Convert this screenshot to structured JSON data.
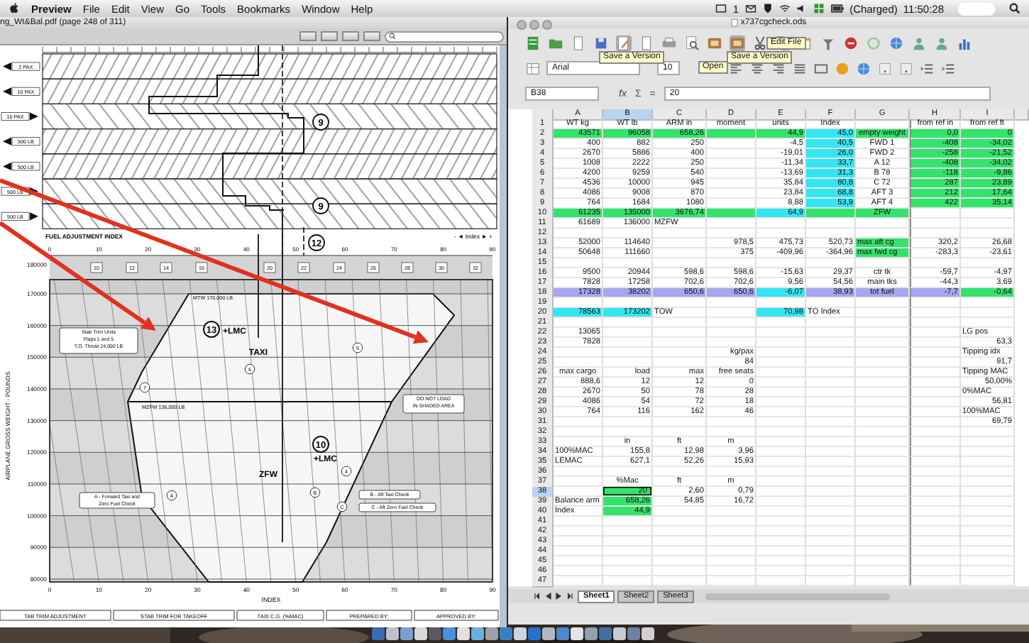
{
  "menu_bar": {
    "items": [
      "Preview",
      "File",
      "Edit",
      "View",
      "Go",
      "Tools",
      "Bookmarks",
      "Window",
      "Help"
    ],
    "space": "1",
    "battery": "(Charged)",
    "time": "11:50:28"
  },
  "preview": {
    "title": "ng_Wt&Bal.pdf (page 248 of 311)",
    "pax_rows": [
      {
        "label": "2 PAX",
        "kind": "left"
      },
      {
        "label": "10 PAX",
        "kind": "left"
      },
      {
        "label": "10 PAX",
        "kind": "right"
      },
      {
        "label": "500 LB",
        "kind": "left"
      },
      {
        "label": "500 LB",
        "kind": "left"
      },
      {
        "label": "500 LB",
        "kind": "right"
      },
      {
        "label": "500 LB",
        "kind": "right"
      }
    ],
    "steps": [
      "9",
      "9",
      "12"
    ],
    "fuel_title": "FUEL ADJUSTMENT INDEX",
    "fuel_legend": "- ◄ Index ► +",
    "fuel_ticks": [
      "0",
      "10",
      "20",
      "30",
      "40",
      "50",
      "60",
      "70",
      "80",
      "90"
    ],
    "trim_boxes": [
      "10",
      "12",
      "14",
      "16",
      "20",
      "22",
      "24",
      "26",
      "28",
      "30",
      "32"
    ],
    "top_weight": "180000",
    "weight_ticks": [
      "170000",
      "160000",
      "150000",
      "140000",
      "130000",
      "120000",
      "110000",
      "100000",
      "90000",
      "80000"
    ],
    "index_ticks": [
      "0",
      "10",
      "20",
      "30",
      "40",
      "50",
      "60",
      "70",
      "80",
      "90"
    ],
    "x_title": "INDEX",
    "y_title": "AIRPLANE GROSS WEIGHT - POUNDS",
    "limit_lines": [
      "MTW 170,000 LB",
      "MZFW 136,000 LB"
    ],
    "notes": [
      {
        "lines": [
          "Stab Trim Units",
          "Flaps 1 and 5",
          "T.O. Thrust 24,000 LB"
        ]
      },
      {
        "lines": [
          "DO NOT LOAD",
          "IN SHADED AREA"
        ]
      },
      {
        "lines": [
          "A - Forward Taxi and",
          "Zero Fuel Check"
        ]
      },
      {
        "lines": [
          "B - Aft Taxi Check"
        ]
      },
      {
        "lines": [
          "C - Aft Zero Fuel Check"
        ]
      }
    ],
    "check_points": [
      {
        "number": "13",
        "mark": "+LMC",
        "label": "TAXI"
      },
      {
        "number": "10",
        "mark": "+LMC",
        "label": "ZFW"
      }
    ],
    "circled": [
      "5",
      "6",
      "7",
      "4",
      "A",
      "B",
      "C"
    ],
    "footer": [
      "TAB TRIM ADJUSTMENT",
      "STAB TRIM FOR TAKEOFF",
      "TAXI C.G. (%MAC)",
      "PREPARED BY:",
      "APPROVED BY:"
    ]
  },
  "calc": {
    "title": "x737cgcheck.ods",
    "tooltips": [
      "Edit File",
      "Save a Version",
      "Save a Version",
      "Open"
    ],
    "font": "Arial",
    "size": "10",
    "cell_ref": "B38",
    "formula_buttons": [
      "fx",
      "Σ",
      "="
    ],
    "formula": "20",
    "columns": [
      "A",
      "B",
      "C",
      "D",
      "E",
      "F",
      "G",
      "H",
      "I"
    ],
    "rows": [
      {
        "n": "1",
        "cells": [
          {
            "text": "WT kg",
            "kind": "center"
          },
          {
            "text": "WT lb",
            "kind": "center"
          },
          {
            "text": "ARM in",
            "kind": "center"
          },
          {
            "text": "moment",
            "kind": "center"
          },
          {
            "text": "units",
            "kind": "center"
          },
          {
            "text": "Index",
            "kind": "center"
          },
          {},
          {
            "text": "from ref in",
            "kind": "center"
          },
          {
            "text": "from ref ft",
            "kind": "center"
          }
        ]
      },
      {
        "n": "2",
        "cells": [
          {
            "text": "43571",
            "kind": "num",
            "color": "#33e36b"
          },
          {
            "text": "96058",
            "kind": "num",
            "color": "#33e36b"
          },
          {
            "text": "658,26",
            "kind": "num",
            "color": "#33e36b"
          },
          {
            "color": "#33e36b"
          },
          {
            "text": "44,9",
            "kind": "num",
            "color": "#33e36b"
          },
          {
            "text": "45,0",
            "kind": "num",
            "color": "#33e6f2"
          },
          {
            "text": "empty weight",
            "kind": "center",
            "color": "#33e36b"
          },
          {
            "text": "0,0",
            "kind": "num",
            "color": "#33e36b"
          },
          {
            "text": "0",
            "kind": "num",
            "color": "#33e36b"
          }
        ]
      },
      {
        "n": "3",
        "cells": [
          {
            "text": "400",
            "kind": "num"
          },
          {
            "text": "882",
            "kind": "num"
          },
          {
            "text": "250",
            "kind": "num"
          },
          {},
          {
            "text": "-4,5",
            "kind": "num"
          },
          {
            "text": "40,5",
            "kind": "num",
            "color": "#33e6f2"
          },
          {
            "text": "FWD 1",
            "kind": "center"
          },
          {
            "text": "-408",
            "kind": "num",
            "color": "#33e36b"
          },
          {
            "text": "-34,02",
            "kind": "num",
            "color": "#33e36b"
          }
        ]
      },
      {
        "n": "4",
        "cells": [
          {
            "text": "2670",
            "kind": "num"
          },
          {
            "text": "5886",
            "kind": "num"
          },
          {
            "text": "400",
            "kind": "num"
          },
          {},
          {
            "text": "-19,01",
            "kind": "num"
          },
          {
            "text": "26,0",
            "kind": "num",
            "color": "#33e6f2"
          },
          {
            "text": "FWD 2",
            "kind": "center"
          },
          {
            "text": "-258",
            "kind": "num",
            "color": "#33e36b"
          },
          {
            "text": "-21,52",
            "kind": "num",
            "color": "#33e36b"
          }
        ]
      },
      {
        "n": "5",
        "cells": [
          {
            "text": "1008",
            "kind": "num"
          },
          {
            "text": "2222",
            "kind": "num"
          },
          {
            "text": "250",
            "kind": "num"
          },
          {},
          {
            "text": "-11,34",
            "kind": "num"
          },
          {
            "text": "33,7",
            "kind": "num",
            "color": "#33e6f2"
          },
          {
            "text": "A 12",
            "kind": "center"
          },
          {
            "text": "-408",
            "kind": "num",
            "color": "#33e36b"
          },
          {
            "text": "-34,02",
            "kind": "num",
            "color": "#33e36b"
          }
        ]
      },
      {
        "n": "6",
        "cells": [
          {
            "text": "4200",
            "kind": "num"
          },
          {
            "text": "9259",
            "kind": "num"
          },
          {
            "text": "540",
            "kind": "num"
          },
          {},
          {
            "text": "-13,69",
            "kind": "num"
          },
          {
            "text": "31,3",
            "kind": "num",
            "color": "#33e6f2"
          },
          {
            "text": "B 78",
            "kind": "center"
          },
          {
            "text": "-118",
            "kind": "num",
            "color": "#33e36b"
          },
          {
            "text": "-9,86",
            "kind": "num",
            "color": "#33e36b"
          }
        ]
      },
      {
        "n": "7",
        "cells": [
          {
            "text": "4536",
            "kind": "num"
          },
          {
            "text": "10000",
            "kind": "num"
          },
          {
            "text": "945",
            "kind": "num"
          },
          {},
          {
            "text": "35,84",
            "kind": "num"
          },
          {
            "text": "80,8",
            "kind": "num",
            "color": "#33e6f2"
          },
          {
            "text": "C 72",
            "kind": "center"
          },
          {
            "text": "287",
            "kind": "num",
            "color": "#33e36b"
          },
          {
            "text": "23,89",
            "kind": "num",
            "color": "#33e36b"
          }
        ]
      },
      {
        "n": "8",
        "cells": [
          {
            "text": "4086",
            "kind": "num"
          },
          {
            "text": "9008",
            "kind": "num"
          },
          {
            "text": "870",
            "kind": "num"
          },
          {},
          {
            "text": "23,84",
            "kind": "num"
          },
          {
            "text": "68,8",
            "kind": "num",
            "color": "#33e6f2"
          },
          {
            "text": "AFT 3",
            "kind": "center"
          },
          {
            "text": "212",
            "kind": "num",
            "color": "#33e36b"
          },
          {
            "text": "17,64",
            "kind": "num",
            "color": "#33e36b"
          }
        ]
      },
      {
        "n": "9",
        "cells": [
          {
            "text": "764",
            "kind": "num"
          },
          {
            "text": "1684",
            "kind": "num"
          },
          {
            "text": "1080",
            "kind": "num"
          },
          {},
          {
            "text": "8,88",
            "kind": "num"
          },
          {
            "text": "53,9",
            "kind": "num",
            "color": "#33e6f2"
          },
          {
            "text": "AFT 4",
            "kind": "center"
          },
          {
            "text": "422",
            "kind": "num",
            "color": "#33e36b"
          },
          {
            "text": "35,14",
            "kind": "num",
            "color": "#33e36b"
          }
        ]
      },
      {
        "n": "10",
        "cells": [
          {
            "text": "61235",
            "kind": "num",
            "color": "#33e36b"
          },
          {
            "text": "135000",
            "kind": "num",
            "color": "#33e36b"
          },
          {
            "text": "3676,74",
            "kind": "num",
            "color": "#33e36b"
          },
          {
            "color": "#33e36b"
          },
          {
            "text": "64,9",
            "kind": "num",
            "color": "#33e6f2"
          },
          {
            "color": "#33e36b"
          },
          {
            "text": "ZFW",
            "kind": "center",
            "color": "#33e36b"
          }
        ]
      },
      {
        "n": "11",
        "cells": [
          {
            "text": "61689",
            "kind": "num"
          },
          {
            "text": "136000",
            "kind": "num"
          },
          {
            "text": "MZFW",
            "kind": "text"
          }
        ]
      },
      {
        "n": "12"
      },
      {
        "n": "13",
        "cells": [
          {
            "text": "52000",
            "kind": "num"
          },
          {
            "text": "114640",
            "kind": "num"
          },
          {},
          {
            "text": "978,5",
            "kind": "num"
          },
          {
            "text": "475,73",
            "kind": "num"
          },
          {
            "text": "520,73",
            "kind": "num"
          },
          {
            "text": "max aft cg",
            "kind": "text",
            "color": "#33e36b"
          },
          {
            "text": "320,2",
            "kind": "num"
          },
          {
            "text": "26,68",
            "kind": "num"
          }
        ]
      },
      {
        "n": "14",
        "cells": [
          {
            "text": "50648",
            "kind": "num"
          },
          {
            "text": "111660",
            "kind": "num"
          },
          {},
          {
            "text": "375",
            "kind": "num"
          },
          {
            "text": "-409,96",
            "kind": "num"
          },
          {
            "text": "-364,96",
            "kind": "num"
          },
          {
            "text": "max fwd cg",
            "kind": "text",
            "color": "#33e36b"
          },
          {
            "text": "-283,3",
            "kind": "num"
          },
          {
            "text": "-23,61",
            "kind": "num"
          }
        ]
      },
      {
        "n": "15"
      },
      {
        "n": "16",
        "cells": [
          {
            "text": "9500",
            "kind": "num"
          },
          {
            "text": "20944",
            "kind": "num"
          },
          {
            "text": "598,6",
            "kind": "num"
          },
          {
            "text": "598,6",
            "kind": "num"
          },
          {
            "text": "-15,63",
            "kind": "num"
          },
          {
            "text": "29,37",
            "kind": "num"
          },
          {
            "text": "ctr tk",
            "kind": "center"
          },
          {
            "text": "-59,7",
            "kind": "num"
          },
          {
            "text": "-4,97",
            "kind": "num"
          }
        ]
      },
      {
        "n": "17",
        "cells": [
          {
            "text": "7828",
            "kind": "num"
          },
          {
            "text": "17258",
            "kind": "num"
          },
          {
            "text": "702,6",
            "kind": "num"
          },
          {
            "text": "702,6",
            "kind": "num"
          },
          {
            "text": "9,56",
            "kind": "num"
          },
          {
            "text": "54,56",
            "kind": "num"
          },
          {
            "text": "main tks",
            "kind": "center"
          },
          {
            "text": "-44,3",
            "kind": "num"
          },
          {
            "text": "3,69",
            "kind": "num"
          }
        ]
      },
      {
        "n": "18",
        "cells": [
          {
            "text": "17328",
            "kind": "num",
            "color": "#a6a6ee"
          },
          {
            "text": "38202",
            "kind": "num",
            "color": "#a6a6ee"
          },
          {
            "text": "650,6",
            "kind": "num",
            "color": "#a6a6ee"
          },
          {
            "text": "650,6",
            "kind": "num",
            "color": "#a6a6ee"
          },
          {
            "text": "-6,07",
            "kind": "num",
            "color": "#33e6f2"
          },
          {
            "text": "38,93",
            "kind": "num",
            "color": "#a6a6ee"
          },
          {
            "text": "tot fuel",
            "kind": "center",
            "color": "#a6a6ee"
          },
          {
            "text": "-7,7",
            "kind": "num",
            "color": "#a6a6ee"
          },
          {
            "text": "-0,64",
            "kind": "num",
            "color": "#33e36b"
          }
        ]
      },
      {
        "n": "19"
      },
      {
        "n": "20",
        "cells": [
          {
            "text": "78563",
            "kind": "num",
            "color": "#33e6f2"
          },
          {
            "text": "173202",
            "kind": "num",
            "color": "#33e6f2"
          },
          {
            "text": "TOW",
            "kind": "text"
          },
          {},
          {
            "text": "70,98",
            "kind": "num",
            "color": "#33e6f2"
          },
          {
            "text": "TO Index",
            "kind": "text"
          }
        ]
      },
      {
        "n": "21"
      },
      {
        "n": "22",
        "cells": [
          {
            "text": "13065",
            "kind": "num"
          },
          {},
          {},
          {},
          {},
          {},
          {},
          {},
          {
            "text": "LG pos",
            "kind": "text"
          }
        ]
      },
      {
        "n": "23",
        "cells": [
          {
            "text": "7828",
            "kind": "num"
          },
          {},
          {},
          {},
          {},
          {},
          {},
          {},
          {
            "text": "63,3",
            "kind": "num"
          }
        ]
      },
      {
        "n": "24",
        "cells": [
          {},
          {},
          {},
          {
            "text": "kg/pax",
            "kind": "num"
          },
          {},
          {},
          {},
          {},
          {
            "text": "Tipping idx",
            "kind": "text"
          }
        ]
      },
      {
        "n": "25",
        "cells": [
          {},
          {},
          {},
          {
            "text": "84",
            "kind": "num"
          },
          {},
          {},
          {},
          {},
          {
            "text": "91,7",
            "kind": "num"
          }
        ]
      },
      {
        "n": "26",
        "cells": [
          {
            "text": "max cargo",
            "kind": "center"
          },
          {
            "text": "load",
            "kind": "num"
          },
          {
            "text": "max",
            "kind": "num"
          },
          {
            "text": "free seats",
            "kind": "num"
          },
          {},
          {},
          {},
          {},
          {
            "text": "Tipping MAC",
            "kind": "text"
          }
        ]
      },
      {
        "n": "27",
        "cells": [
          {
            "text": "888,6",
            "kind": "num"
          },
          {
            "text": "12",
            "kind": "num"
          },
          {
            "text": "12",
            "kind": "num"
          },
          {
            "text": "0",
            "kind": "num"
          },
          {},
          {},
          {},
          {},
          {
            "text": "50,00%",
            "kind": "num"
          }
        ]
      },
      {
        "n": "28",
        "cells": [
          {
            "text": "2670",
            "kind": "num"
          },
          {
            "text": "50",
            "kind": "num"
          },
          {
            "text": "78",
            "kind": "num"
          },
          {
            "text": "28",
            "kind": "num"
          },
          {},
          {},
          {},
          {},
          {
            "text": "0%MAC",
            "kind": "text"
          }
        ]
      },
      {
        "n": "29",
        "cells": [
          {
            "text": "4086",
            "kind": "num"
          },
          {
            "text": "54",
            "kind": "num"
          },
          {
            "text": "72",
            "kind": "num"
          },
          {
            "text": "18",
            "kind": "num"
          },
          {},
          {},
          {},
          {},
          {
            "text": "56,81",
            "kind": "num"
          }
        ]
      },
      {
        "n": "30",
        "cells": [
          {
            "text": "764",
            "kind": "num"
          },
          {
            "text": "116",
            "kind": "num"
          },
          {
            "text": "162",
            "kind": "num"
          },
          {
            "text": "46",
            "kind": "num"
          },
          {},
          {},
          {},
          {},
          {
            "text": "100%MAC",
            "kind": "text"
          }
        ]
      },
      {
        "n": "31",
        "cells": [
          {},
          {},
          {},
          {},
          {},
          {},
          {},
          {},
          {
            "text": "69,79",
            "kind": "num"
          }
        ]
      },
      {
        "n": "32"
      },
      {
        "n": "33",
        "cells": [
          {},
          {
            "text": "in",
            "kind": "center"
          },
          {
            "text": "ft",
            "kind": "center"
          },
          {
            "text": "m",
            "kind": "center"
          }
        ]
      },
      {
        "n": "34",
        "cells": [
          {
            "text": "100%MAC",
            "kind": "text"
          },
          {
            "text": "155,8",
            "kind": "num"
          },
          {
            "text": "12,98",
            "kind": "num"
          },
          {
            "text": "3,96",
            "kind": "num"
          }
        ]
      },
      {
        "n": "35",
        "cells": [
          {
            "text": "LEMAC",
            "kind": "text"
          },
          {
            "text": "627,1",
            "kind": "num"
          },
          {
            "text": "52,26",
            "kind": "num"
          },
          {
            "text": "15,93",
            "kind": "num"
          }
        ]
      },
      {
        "n": "36"
      },
      {
        "n": "37",
        "cells": [
          {},
          {
            "text": "%Mac",
            "kind": "center"
          },
          {
            "text": "ft",
            "kind": "center"
          },
          {
            "text": "m",
            "kind": "center"
          }
        ]
      },
      {
        "n": "38",
        "cells": [
          {},
          {
            "text": "20",
            "kind": "num",
            "color": "#33e36b",
            "selected": true
          },
          {
            "text": "2,60",
            "kind": "num"
          },
          {
            "text": "0,79",
            "kind": "num"
          }
        ]
      },
      {
        "n": "39",
        "cells": [
          {
            "text": "Balance arm",
            "kind": "text"
          },
          {
            "text": "658,26",
            "kind": "num",
            "color": "#33e36b"
          },
          {
            "text": "54,85",
            "kind": "num"
          },
          {
            "text": "16,72",
            "kind": "num"
          }
        ]
      },
      {
        "n": "40",
        "cells": [
          {
            "text": "Index",
            "kind": "text"
          },
          {
            "text": "44,9",
            "kind": "num",
            "color": "#33e36b"
          }
        ]
      },
      {
        "n": "41"
      },
      {
        "n": "42"
      },
      {
        "n": "43"
      },
      {
        "n": "44"
      },
      {
        "n": "45"
      },
      {
        "n": "46"
      },
      {
        "n": "47"
      }
    ],
    "sheets": [
      {
        "label": "Sheet1",
        "selected": true
      },
      {
        "label": "Sheet2",
        "selected": false
      },
      {
        "label": "Sheet3",
        "selected": false
      }
    ]
  }
}
